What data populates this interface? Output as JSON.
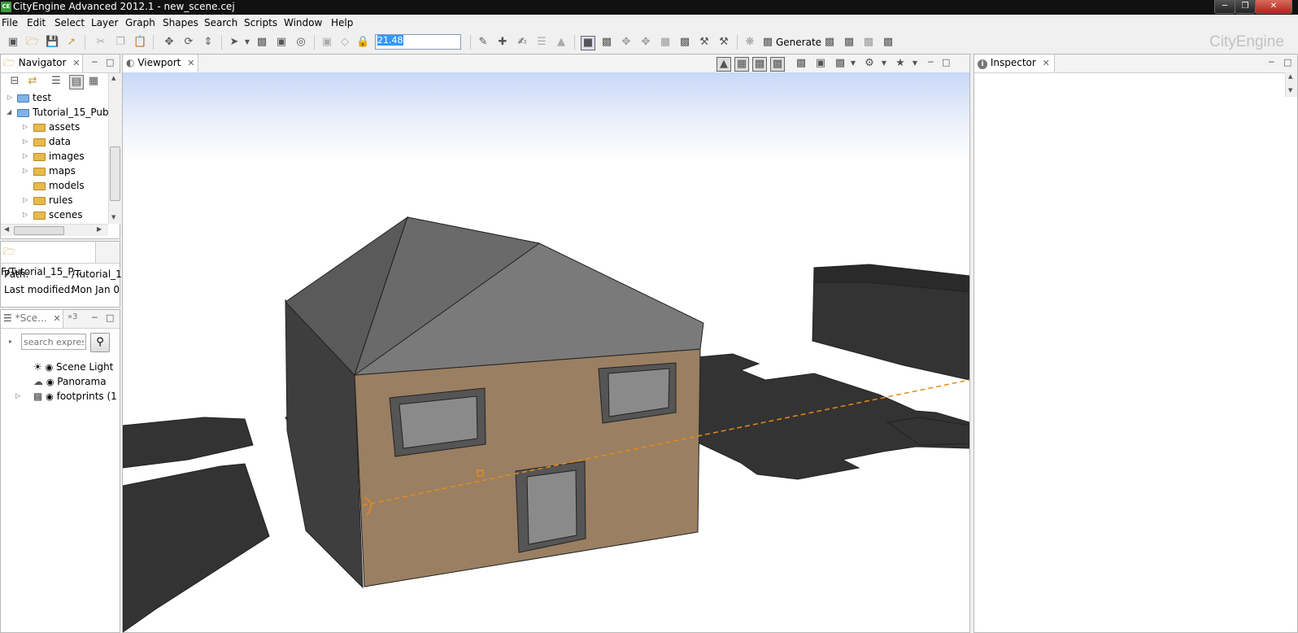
{
  "app": {
    "window_title": "CityEngine Advanced 2012.1 - new_scene.cej",
    "app_icon_text": "CE",
    "brand": "CityEngine"
  },
  "menu": [
    "File",
    "Edit",
    "Select",
    "Layer",
    "Graph",
    "Shapes",
    "Search",
    "Scripts",
    "Window",
    "Help"
  ],
  "toolbar": {
    "zoom_value": "21.48",
    "generate_label": "Generate"
  },
  "navigator": {
    "tab_label": "Navigator",
    "items": [
      {
        "label": "test",
        "expanded": false,
        "level": 0
      },
      {
        "label": "Tutorial_15_Publ",
        "expanded": true,
        "level": 0
      },
      {
        "label": "assets",
        "level": 1
      },
      {
        "label": "data",
        "level": 1
      },
      {
        "label": "images",
        "level": 1
      },
      {
        "label": "maps",
        "level": 1
      },
      {
        "label": "models",
        "level": 1
      },
      {
        "label": "rules",
        "level": 1
      },
      {
        "label": "scenes",
        "level": 1
      }
    ]
  },
  "properties": {
    "tab_label": "F/Tutorial_15_P...",
    "path_label": "Path:",
    "path_value": "/Tutorial_1",
    "modified_label": "Last modified:",
    "modified_value": "Mon Jan 0"
  },
  "scene": {
    "tab_label": "*Sce...",
    "tab2_label": "»3",
    "search_placeholder": "search expres",
    "items": [
      {
        "label": "Scene Light"
      },
      {
        "label": "Panorama"
      },
      {
        "label": "footprints (1"
      }
    ]
  },
  "viewport": {
    "tab_label": "Viewport",
    "sky_color": "#c8d8f8",
    "wall_color": "#9a7f62",
    "roof_color": "#7a7a7a",
    "shadow_color": "#333333"
  },
  "inspector": {
    "tab_label": "Inspector"
  }
}
